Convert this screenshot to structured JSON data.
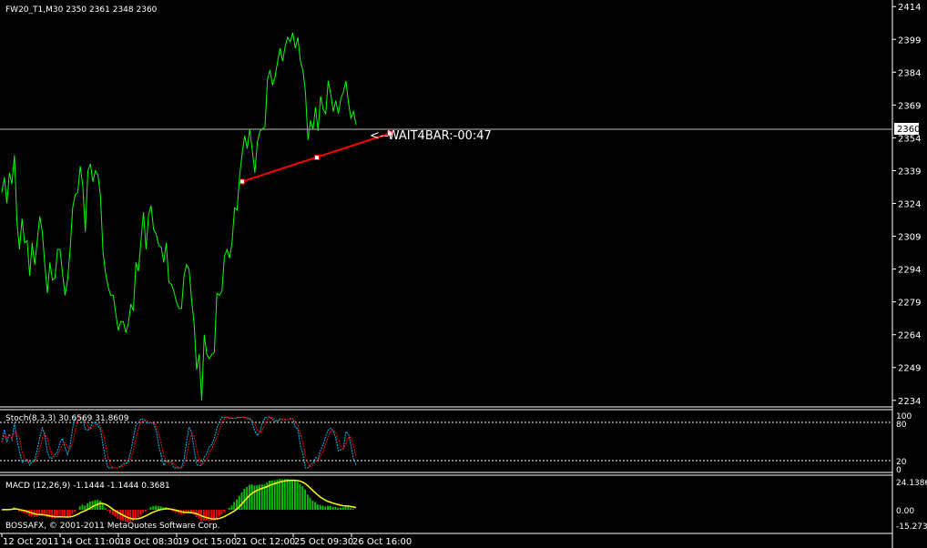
{
  "window": {
    "symbol_title": "FW20_T1,M30  2350 2361 2348 2360"
  },
  "annotations": {
    "wait_text": "<--WAIT4BAR:-00:47",
    "copyright": "BOSSAFX, © 2001-2011 MetaQuotes Software Corp."
  },
  "colors": {
    "background": "#000000",
    "price_line": "#00ff00",
    "trendline": "#ff0000",
    "stoch_main": "#00bfff",
    "stoch_signal": "#ff0000",
    "macd_hist_pos": "#00c000",
    "macd_hist_neg": "#ff0000",
    "macd_signal": "#ffff00",
    "axis_text": "#ffffff",
    "pane_border": "#ffffff"
  },
  "main_axis": {
    "tick_labels": [
      "2414",
      "2399",
      "2384",
      "2369",
      "2354",
      "2339",
      "2324",
      "2309",
      "2294",
      "2279",
      "2264",
      "2249",
      "2234"
    ],
    "current_price_label": "2360",
    "ylim": [
      2231,
      2417
    ]
  },
  "stoch": {
    "title": "Stoch(8,3,3) 30.6569 31.8609",
    "tick_labels": [
      "100",
      "80",
      "20",
      "0"
    ]
  },
  "macd": {
    "title": "MACD (12,26,9) -1.1444 -1.1444 0.3681",
    "tick_labels": [
      "24.1386",
      "0.00",
      "-15.2734"
    ]
  },
  "time_axis": {
    "labels": [
      "12 Oct 2011",
      "14 Oct 11:00",
      "18 Oct 08:30",
      "19 Oct 15:00",
      "21 Oct 12:00",
      "25 Oct 09:30",
      "26 Oct 16:00"
    ]
  },
  "chart_data": {
    "type": "line",
    "title": "FW20_T1,M30  2350 2361 2348 2360",
    "series": [
      {
        "values": [
          2329,
          2336,
          2324,
          2338,
          2333,
          2346,
          2315,
          2303,
          2317,
          2306,
          2307,
          2291,
          2306,
          2296,
          2307,
          2318,
          2311,
          2296,
          2283,
          2297,
          2289,
          2290,
          2303,
          2303,
          2292,
          2282,
          2289,
          2303,
          2322,
          2328,
          2329,
          2341,
          2332,
          2311,
          2339,
          2342,
          2334,
          2339,
          2337,
          2327,
          2302,
          2292,
          2286,
          2282,
          2282,
          2274,
          2266,
          2270,
          2270,
          2265,
          2269,
          2278,
          2275,
          2297,
          2293,
          2307,
          2320,
          2303,
          2319,
          2323,
          2312,
          2310,
          2305,
          2304,
          2297,
          2306,
          2288,
          2287,
          2284,
          2279,
          2276,
          2276,
          2291,
          2296,
          2294,
          2280,
          2269,
          2248,
          2255,
          2234,
          2264,
          2255,
          2253,
          2255,
          2256,
          2283,
          2282,
          2284,
          2300,
          2303,
          2299,
          2306,
          2322,
          2321,
          2337,
          2347,
          2355,
          2349,
          2358,
          2348,
          2338,
          2352,
          2357,
          2358,
          2359,
          2381,
          2385,
          2378,
          2382,
          2389,
          2395,
          2389,
          2396,
          2400,
          2398,
          2402,
          2395,
          2400,
          2389,
          2385,
          2375,
          2353,
          2362,
          2358,
          2368,
          2357,
          2373,
          2367,
          2365,
          2380,
          2374,
          2366,
          2371,
          2365,
          2372,
          2375,
          2380,
          2370,
          2363,
          2366,
          2360
        ]
      }
    ],
    "trendline": {
      "points": [
        [
          0,
          2334
        ],
        [
          1,
          2345
        ],
        [
          2,
          2356
        ]
      ]
    },
    "ylim": [
      2231,
      2417
    ],
    "current_price": 2360
  }
}
